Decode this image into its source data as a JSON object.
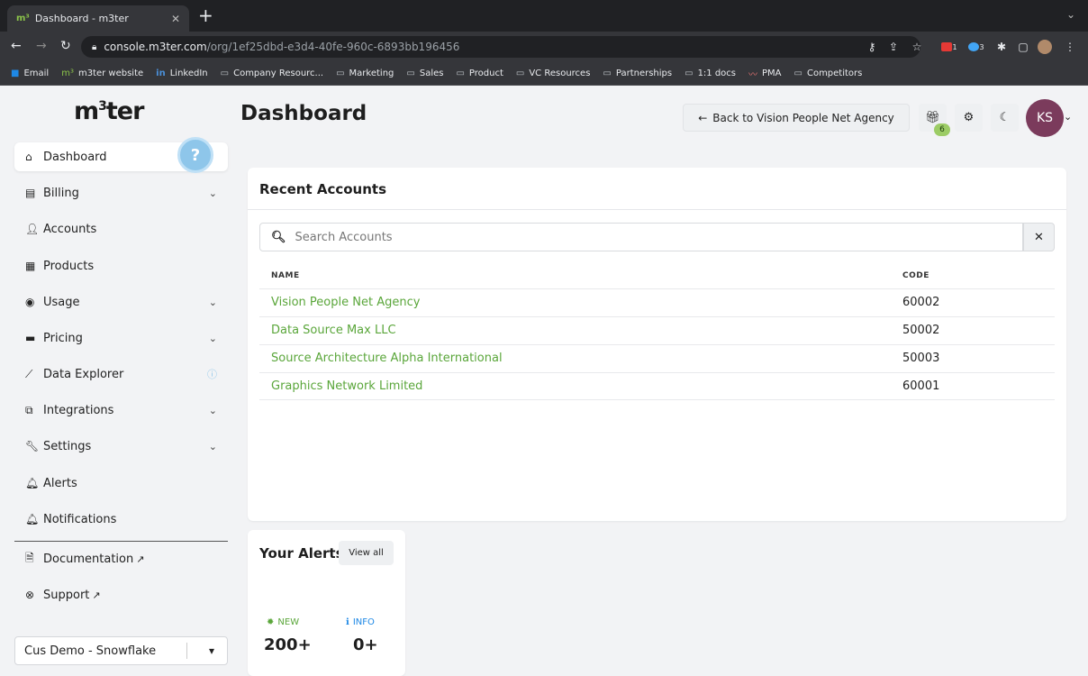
{
  "browser": {
    "tab_title": "Dashboard - m3ter",
    "favicon_text": "m³",
    "url_host": "console.m3ter.com",
    "url_path": "/org/1ef25dbd-e3d4-40fe-960c-6893bb196456",
    "bookmarks": [
      "Email",
      "m3ter website",
      "LinkedIn",
      "Company Resourc...",
      "Marketing",
      "Sales",
      "Product",
      "VC Resources",
      "Partnerships",
      "1:1 docs",
      "PMA",
      "Competitors"
    ],
    "ext_badge_1": "1",
    "ext_badge_2": "3"
  },
  "brand": {
    "logo_main": "m",
    "logo_sup": "3",
    "logo_tail": "ter"
  },
  "sidebar": {
    "items": [
      {
        "label": "Dashboard",
        "icon": "home-icon"
      },
      {
        "label": "Billing",
        "icon": "billing-icon"
      },
      {
        "label": "Accounts",
        "icon": "user-icon"
      },
      {
        "label": "Products",
        "icon": "box-icon"
      },
      {
        "label": "Usage",
        "icon": "gauge-icon"
      },
      {
        "label": "Pricing",
        "icon": "money-icon"
      },
      {
        "label": "Data Explorer",
        "icon": "chart-icon"
      },
      {
        "label": "Integrations",
        "icon": "integrations-icon"
      },
      {
        "label": "Settings",
        "icon": "wrench-icon"
      },
      {
        "label": "Alerts",
        "icon": "bell-icon"
      },
      {
        "label": "Notifications",
        "icon": "bell-icon"
      },
      {
        "label": "Documentation",
        "icon": "document-icon"
      },
      {
        "label": "Support",
        "icon": "lifebuoy-icon"
      }
    ],
    "org_select": "Cus Demo - Snowflake",
    "help_glyph": "?"
  },
  "header": {
    "title": "Dashboard",
    "back_button": "Back to Vision People Net Agency",
    "gift_badge": "6",
    "avatar_initials": "KS"
  },
  "recent_accounts": {
    "title": "Recent Accounts",
    "search_placeholder": "Search Accounts",
    "columns": {
      "name": "NAME",
      "code": "CODE"
    },
    "rows": [
      {
        "name": "Vision People Net Agency",
        "code": "60002"
      },
      {
        "name": "Data Source Max LLC",
        "code": "50002"
      },
      {
        "name": "Source Architecture Alpha International",
        "code": "50003"
      },
      {
        "name": "Graphics Network Limited",
        "code": "60001"
      }
    ]
  },
  "alerts": {
    "title": "Your Alerts",
    "view_all": "View all",
    "new_label": "NEW",
    "new_value": "200+",
    "info_label": "INFO",
    "info_value": "0+"
  }
}
